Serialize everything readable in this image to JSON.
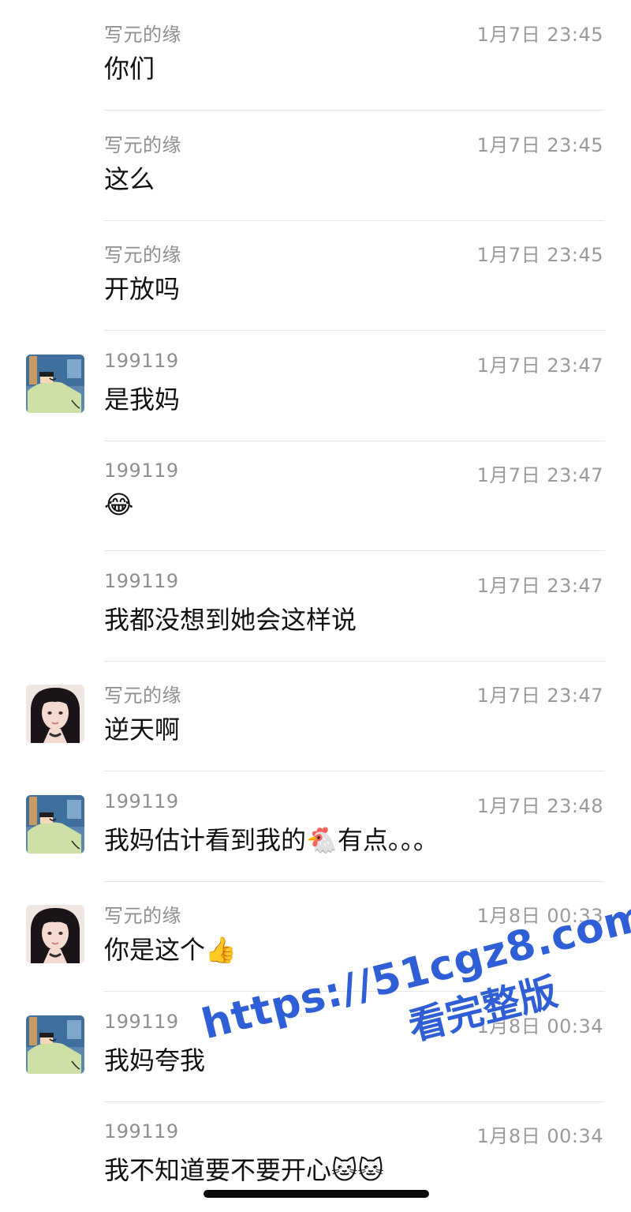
{
  "messages": [
    {
      "sender": "写元的缘",
      "time": "1月7日 23:45",
      "text": "你们",
      "avatar": ""
    },
    {
      "sender": "写元的缘",
      "time": "1月7日 23:45",
      "text": "这么",
      "avatar": ""
    },
    {
      "sender": "写元的缘",
      "time": "1月7日 23:45",
      "text": "开放吗",
      "avatar": ""
    },
    {
      "sender": "199119",
      "time": "1月7日 23:47",
      "text": "是我妈",
      "avatar": "cartoon"
    },
    {
      "sender": "199119",
      "time": "1月7日 23:47",
      "text": "😂",
      "avatar": ""
    },
    {
      "sender": "199119",
      "time": "1月7日 23:47",
      "text": "我都没想到她会这样说",
      "avatar": ""
    },
    {
      "sender": "写元的缘",
      "time": "1月7日 23:47",
      "text": "逆天啊",
      "avatar": "girl"
    },
    {
      "sender": "199119",
      "time": "1月7日 23:48",
      "text": "我妈估计看到我的🐔有点。。。",
      "avatar": "cartoon"
    },
    {
      "sender": "写元的缘",
      "time": "1月8日 00:33",
      "text": "你是这个👍",
      "avatar": "girl"
    },
    {
      "sender": "199119",
      "time": "1月8日 00:34",
      "text": "我妈夸我",
      "avatar": "cartoon"
    },
    {
      "sender": "199119",
      "time": "1月8日 00:34",
      "text": "我不知道要不要开心🐱🐱",
      "avatar": ""
    }
  ],
  "watermark": {
    "line1": "https://51cgz8.com",
    "line2": "看完整版"
  },
  "colors": {
    "sender": "#8e8e8e",
    "time": "#9a9a9a",
    "text": "#111111",
    "divider": "#e4e4e4",
    "watermark": "#2f5fd6"
  }
}
